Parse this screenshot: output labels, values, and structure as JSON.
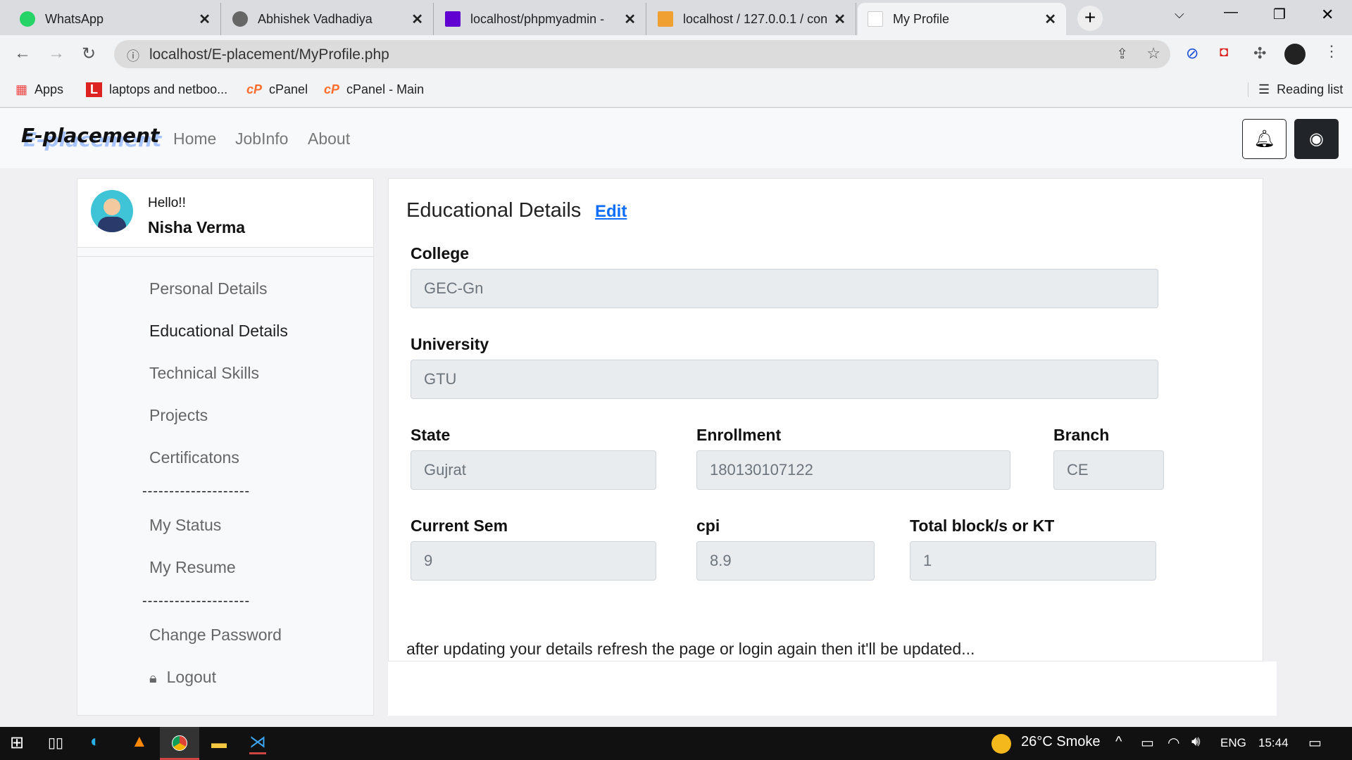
{
  "browser": {
    "tabs": [
      {
        "label": "WhatsApp",
        "icon": "whatsapp-icon"
      },
      {
        "label": "Abhishek Vadhadiya",
        "icon": "globe-icon"
      },
      {
        "label": "localhost/phpmyadmin - ",
        "icon": "yahoo-icon"
      },
      {
        "label": "localhost / 127.0.0.1 / con",
        "icon": "phpmyadmin-icon"
      },
      {
        "label": "My Profile",
        "icon": "page-icon"
      }
    ],
    "url": "localhost/E-placement/MyProfile.php",
    "bookmarks": [
      "Apps",
      "laptops and netboo...",
      "cPanel",
      "cPanel - Main"
    ],
    "reading_list": "Reading list"
  },
  "navbar": {
    "brand": "E-placement",
    "links": [
      "Home",
      "JobInfo",
      "About"
    ]
  },
  "sidebar": {
    "greeting": "Hello!!",
    "name": "Nisha Verma",
    "items": [
      "Personal Details",
      "Educational Details",
      "Technical Skills",
      "Projects",
      "Certificatons",
      "My Status",
      "My Resume",
      "Change Password",
      "Logout"
    ],
    "divider": "--------------------"
  },
  "main": {
    "title": "Educational Details",
    "edit": "Edit",
    "fields": {
      "college": {
        "label": "College",
        "value": "GEC-Gn"
      },
      "university": {
        "label": "University",
        "value": "GTU"
      },
      "state": {
        "label": "State",
        "value": "Gujrat"
      },
      "enrollment": {
        "label": "Enrollment",
        "value": "180130107122"
      },
      "branch": {
        "label": "Branch",
        "value": "CE"
      },
      "sem": {
        "label": "Current Sem",
        "value": "9"
      },
      "cpi": {
        "label": "cpi",
        "value": "8.9"
      },
      "kt": {
        "label": "Total block/s or KT",
        "value": "1"
      }
    },
    "note": "after updating your details refresh the page or login again then it'll be updated..."
  },
  "taskbar": {
    "weather": "26°C  Smoke",
    "lang": "ENG",
    "time": "15:44"
  }
}
